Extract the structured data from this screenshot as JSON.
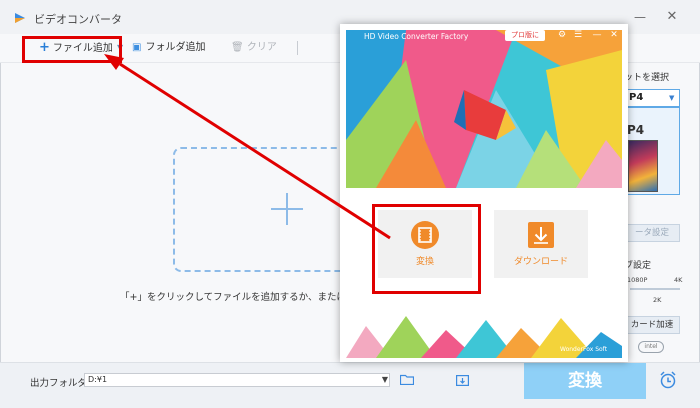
{
  "window": {
    "title": "ビデオコンバータ",
    "minimize_icon": "minimize-icon",
    "close_icon": "close-icon"
  },
  "toolbar": {
    "add_file_label": "ファイル追加",
    "add_folder_label": "フォルダ追加",
    "clear_label": "クリア"
  },
  "main": {
    "hint_text": "「+」をクリックしてファイルを追加するか、またはファイ"
  },
  "bottom": {
    "output_folder_label": "出力フォルダ：",
    "output_folder_value": "D:¥1",
    "convert_label": "変換"
  },
  "right_panel": {
    "format_label": "ットを選択",
    "format_value": "P4",
    "thumb_label": "P4",
    "setting_button": "ータ設定",
    "quality_label": "ブ設定",
    "quality_marks": [
      "1080P",
      "4K",
      "2K"
    ],
    "accel_button": "カード加速",
    "intel_badge": "intel"
  },
  "overlay": {
    "title": "HD Video Converter Factory",
    "promo_label": "プロ版に",
    "convert_card_label": "変換",
    "download_card_label": "ダウンロード",
    "brand": "WonderFox Soft"
  },
  "colors": {
    "annotation_red": "#e00000",
    "accent_blue": "#2a7fd8",
    "convert_button": "#8fd0f7",
    "card_orange": "#f08a2a"
  }
}
